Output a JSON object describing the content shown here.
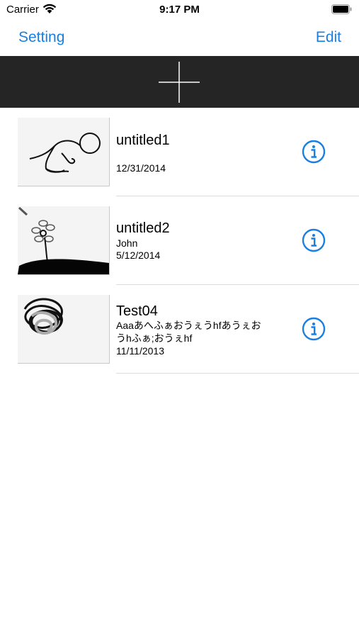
{
  "status_bar": {
    "carrier": "Carrier",
    "time": "9:17 PM",
    "wifi_icon": "wifi-icon",
    "battery_icon": "battery-icon"
  },
  "navbar": {
    "left_label": "Setting",
    "right_label": "Edit",
    "accent_color": "#1a7fe0"
  },
  "toolbar": {
    "add_icon": "plus-icon",
    "background": "#252525"
  },
  "documents": [
    {
      "title": "untitled1",
      "author": "",
      "description_line1": "",
      "description_line2": "",
      "date": "12/31/2014",
      "thumbnail": "stick-figure-sketch",
      "info_icon": "info-icon"
    },
    {
      "title": "untitled2",
      "author": "John",
      "description_line1": "",
      "description_line2": "",
      "date": "5/12/2014",
      "thumbnail": "flower-sketch",
      "info_icon": "info-icon"
    },
    {
      "title": "Test04",
      "author": "",
      "description_line1": "Aaaあへふぁおうぇうhfあうぇお",
      "description_line2": "うhふぁ;おうぇhf",
      "date": "11/11/2013",
      "thumbnail": "scribble-sketch",
      "info_icon": "info-icon"
    }
  ]
}
